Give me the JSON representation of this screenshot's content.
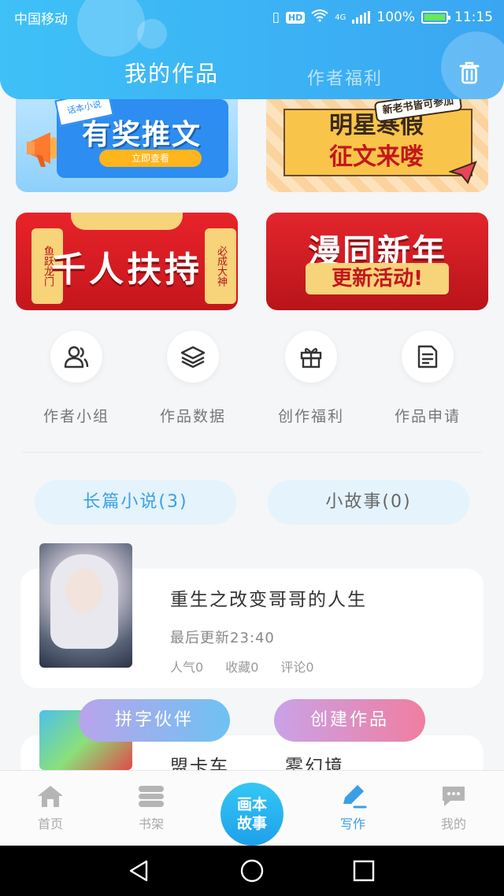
{
  "status_bar": {
    "carrier": "中国移动",
    "hd": "HD",
    "network": "4G",
    "battery": "100%",
    "time": "11:15"
  },
  "header": {
    "tab_mine": "我的作品",
    "tab_welfare": "作者福利"
  },
  "banners": [
    {
      "title": "有奖推文",
      "button": "立即查看",
      "note": "话本小说"
    },
    {
      "tag": "新老书皆可参加",
      "title_line1": "明星寒假",
      "title_line2": "征文来喽"
    },
    {
      "title": "千人扶持",
      "left_scroll": "鱼跃龙门",
      "right_scroll": "必成大神"
    },
    {
      "title": "漫同新年",
      "subtitle": "更新活动!"
    }
  ],
  "quick_actions": [
    {
      "label": "作者小组",
      "icon": "group-icon"
    },
    {
      "label": "作品数据",
      "icon": "layers-icon"
    },
    {
      "label": "创作福利",
      "icon": "gift-icon"
    },
    {
      "label": "作品申请",
      "icon": "document-icon"
    }
  ],
  "categories": {
    "long": "长篇小说(3)",
    "short": "小故事(0)"
  },
  "works": [
    {
      "title": "重生之改变哥哥的人生",
      "updated": "最后更新23:40",
      "popularity": "人气0",
      "favorites": "收藏0",
      "comments": "评论0"
    },
    {
      "title": "盟卡车"
    }
  ],
  "work2_title_end": "雾幻境",
  "floating_buttons": {
    "partner": "拼字伙伴",
    "create": "创建作品"
  },
  "bottom_nav": {
    "home": "首页",
    "shelf": "书架",
    "center_line1": "画本",
    "center_line2": "故事",
    "write": "写作",
    "mine": "我的"
  },
  "colors": {
    "header": "#3aa6f2",
    "accent": "#3a9fe6"
  }
}
